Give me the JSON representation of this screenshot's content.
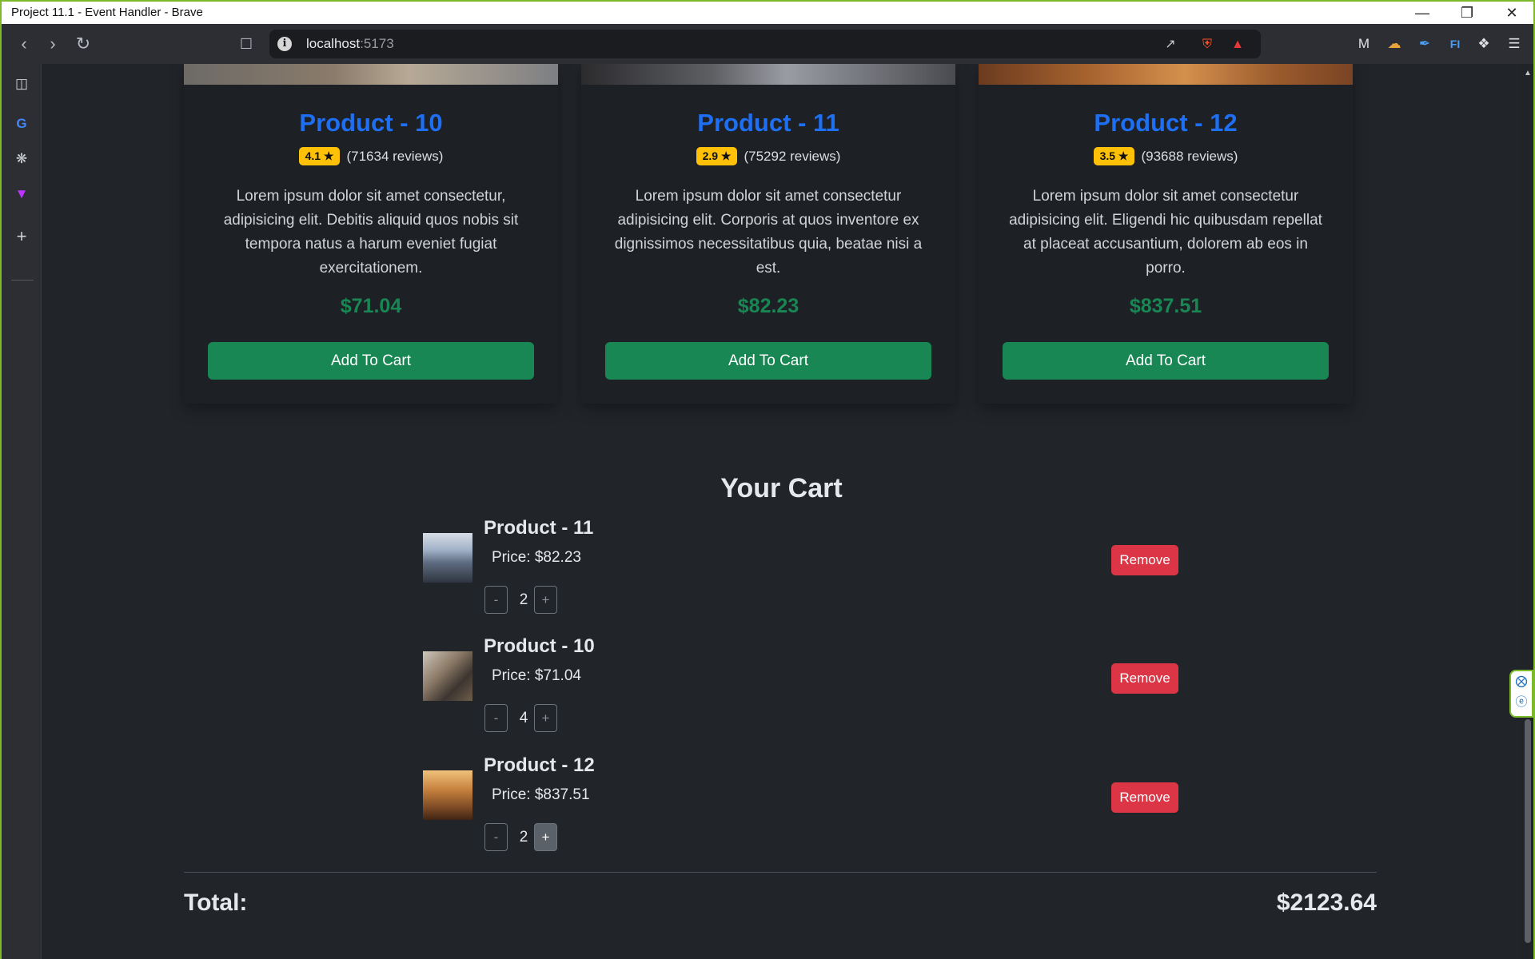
{
  "window": {
    "title": "Project 11.1 - Event Handler - Brave"
  },
  "browser": {
    "url_host": "localhost",
    "url_port": ":5173"
  },
  "products": [
    {
      "name": "Product - 10",
      "rating": "4.1 ★",
      "reviews": "(71634 reviews)",
      "description": "Lorem ipsum dolor sit amet consectetur, adipisicing elit. Debitis aliquid quos nobis sit tempora natus a harum eveniet fugiat exercitationem.",
      "price": "$71.04",
      "button": "Add To Cart"
    },
    {
      "name": "Product - 11",
      "rating": "2.9 ★",
      "reviews": "(75292 reviews)",
      "description": "Lorem ipsum dolor sit amet consectetur adipisicing elit. Corporis at quos inventore ex dignissimos necessitatibus quia, beatae nisi a est.",
      "price": "$82.23",
      "button": "Add To Cart"
    },
    {
      "name": "Product - 12",
      "rating": "3.5 ★",
      "reviews": "(93688 reviews)",
      "description": "Lorem ipsum dolor sit amet consectetur adipisicing elit. Eligendi hic quibusdam repellat at placeat accusantium, dolorem ab eos in porro.",
      "price": "$837.51",
      "button": "Add To Cart"
    }
  ],
  "cart": {
    "title": "Your Cart",
    "items": [
      {
        "name": "Product - 11",
        "price": "Price: $82.23",
        "qty": "2",
        "minus": "-",
        "plus": "+",
        "remove": "Remove"
      },
      {
        "name": "Product - 10",
        "price": "Price: $71.04",
        "qty": "4",
        "minus": "-",
        "plus": "+",
        "remove": "Remove"
      },
      {
        "name": "Product - 12",
        "price": "Price: $837.51",
        "qty": "2",
        "minus": "-",
        "plus": "+",
        "remove": "Remove"
      }
    ],
    "total_label": "Total:",
    "total_value": "$2123.64"
  },
  "colors": {
    "accent_blue": "#1f6ff3",
    "success": "#198754",
    "danger": "#dc3545",
    "warning": "#ffc107",
    "frame": "#7cba2a"
  }
}
